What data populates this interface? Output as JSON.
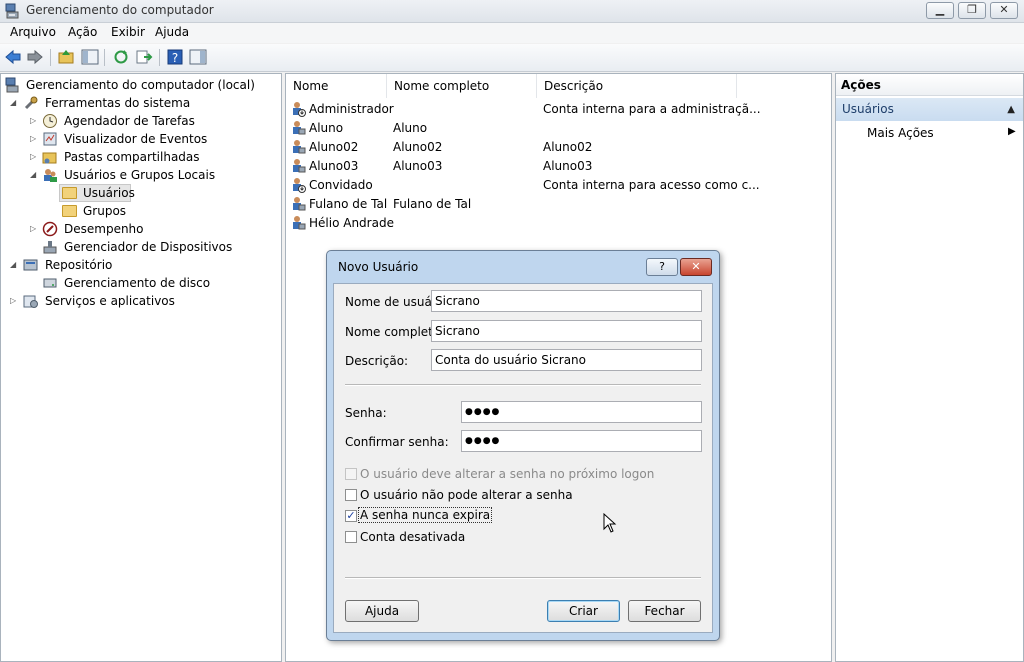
{
  "window": {
    "title": "Gerenciamento do computador"
  },
  "menu": [
    "Arquivo",
    "Ação",
    "Exibir",
    "Ajuda"
  ],
  "tree": {
    "root": "Gerenciamento do computador (local)",
    "system_tools": "Ferramentas do sistema",
    "task_scheduler": "Agendador de Tarefas",
    "event_viewer": "Visualizador de Eventos",
    "shared_folders": "Pastas compartilhadas",
    "local_users": "Usuários e Grupos Locais",
    "users": "Usuários",
    "groups": "Grupos",
    "performance": "Desempenho",
    "device_manager": "Gerenciador de Dispositivos",
    "storage": "Repositório",
    "disk_management": "Gerenciamento de disco",
    "services": "Serviços e aplicativos"
  },
  "list": {
    "columns": [
      "Nome",
      "Nome completo",
      "Descrição"
    ],
    "rows": [
      {
        "name": "Administrador",
        "full": "",
        "desc": "Conta interna para a administraçã..."
      },
      {
        "name": "Aluno",
        "full": "Aluno",
        "desc": ""
      },
      {
        "name": "Aluno02",
        "full": "Aluno02",
        "desc": "Aluno02"
      },
      {
        "name": "Aluno03",
        "full": "Aluno03",
        "desc": "Aluno03"
      },
      {
        "name": "Convidado",
        "full": "",
        "desc": "Conta interna para acesso como c..."
      },
      {
        "name": "Fulano de Tal",
        "full": "Fulano de Tal",
        "desc": ""
      },
      {
        "name": "Hélio Andrade",
        "full": "",
        "desc": ""
      }
    ]
  },
  "actions": {
    "header": "Ações",
    "section": "Usuários",
    "more": "Mais Ações"
  },
  "dialog": {
    "title": "Novo Usuário",
    "help_glyph": "?",
    "close_glyph": "✕",
    "username_label": "Nome de usuário:",
    "username_value": "Sicrano",
    "fullname_label": "Nome completo:",
    "fullname_value": "Sicrano",
    "description_label": "Descrição:",
    "description_value": "Conta do usuário Sicrano",
    "password_label": "Senha:",
    "password_value": "●●●●",
    "confirm_label": "Confirmar senha:",
    "confirm_value": "●●●●",
    "cb_must_change": "O usuário deve alterar a senha no próximo logon",
    "cb_cannot_change": "O usuário não pode alterar a senha",
    "cb_never_expires": "A senha nunca expira",
    "cb_disabled": "Conta desativada",
    "checked_glyph": "✓",
    "help_button": "Ajuda",
    "create_button": "Criar",
    "close_button": "Fechar"
  }
}
